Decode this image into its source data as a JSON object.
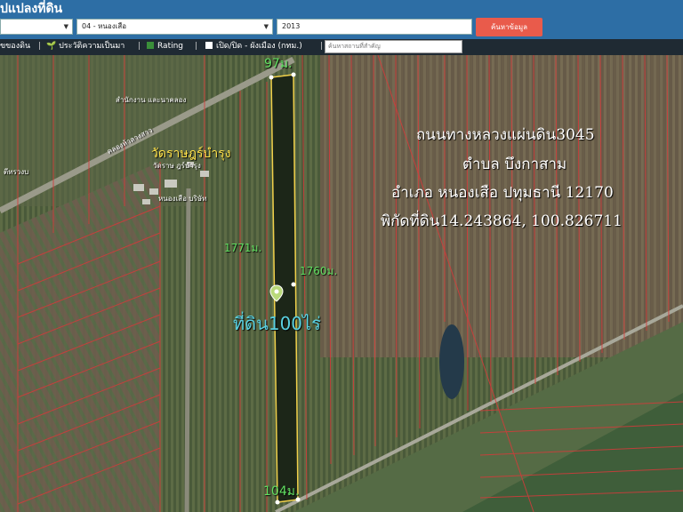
{
  "header": {
    "title": "ูปแปลงที่ดิน",
    "select_province": "",
    "select_district": "04 - หนองเสือ",
    "year_value": "2013",
    "search_button": "ค้นหาข้อมูล"
  },
  "toolbar": {
    "item1": "ขของดิน",
    "item2": "ประวัติความเป็นมา",
    "item3": "Rating",
    "item4": "เปิด/ปิด - ผังเมือง (กทม.)",
    "place_placeholder": "ค้นหาสถานที่สำคัญ"
  },
  "map": {
    "road_label": "ถนนทางหลวงแผ่นดิน3045",
    "subdistrict_label": "ตำบล บึงกาสาม",
    "district_label": "อำเภอ หนองเสือ ปทุมธานี 12170",
    "coordinates_label": "พิกัดที่ดิน14.243864, 100.826711",
    "area_label": "ที่ดิน100ไร่",
    "dim_top": "97ม.",
    "dim_left": "1771ม.",
    "dim_right": "1760ม.",
    "dim_bottom": "104ม.",
    "temple_label": "วัดราษฎร์บำรุง",
    "small_label_1": "สำนักงาน และนาคลอง",
    "small_label_2": "วัดราษ ฎร์บำรุง",
    "small_label_3": "หนองเสือ บริษัท",
    "small_label_4": "ตีทรวงบ",
    "small_label_5": "คลองห้าลางสาว"
  }
}
